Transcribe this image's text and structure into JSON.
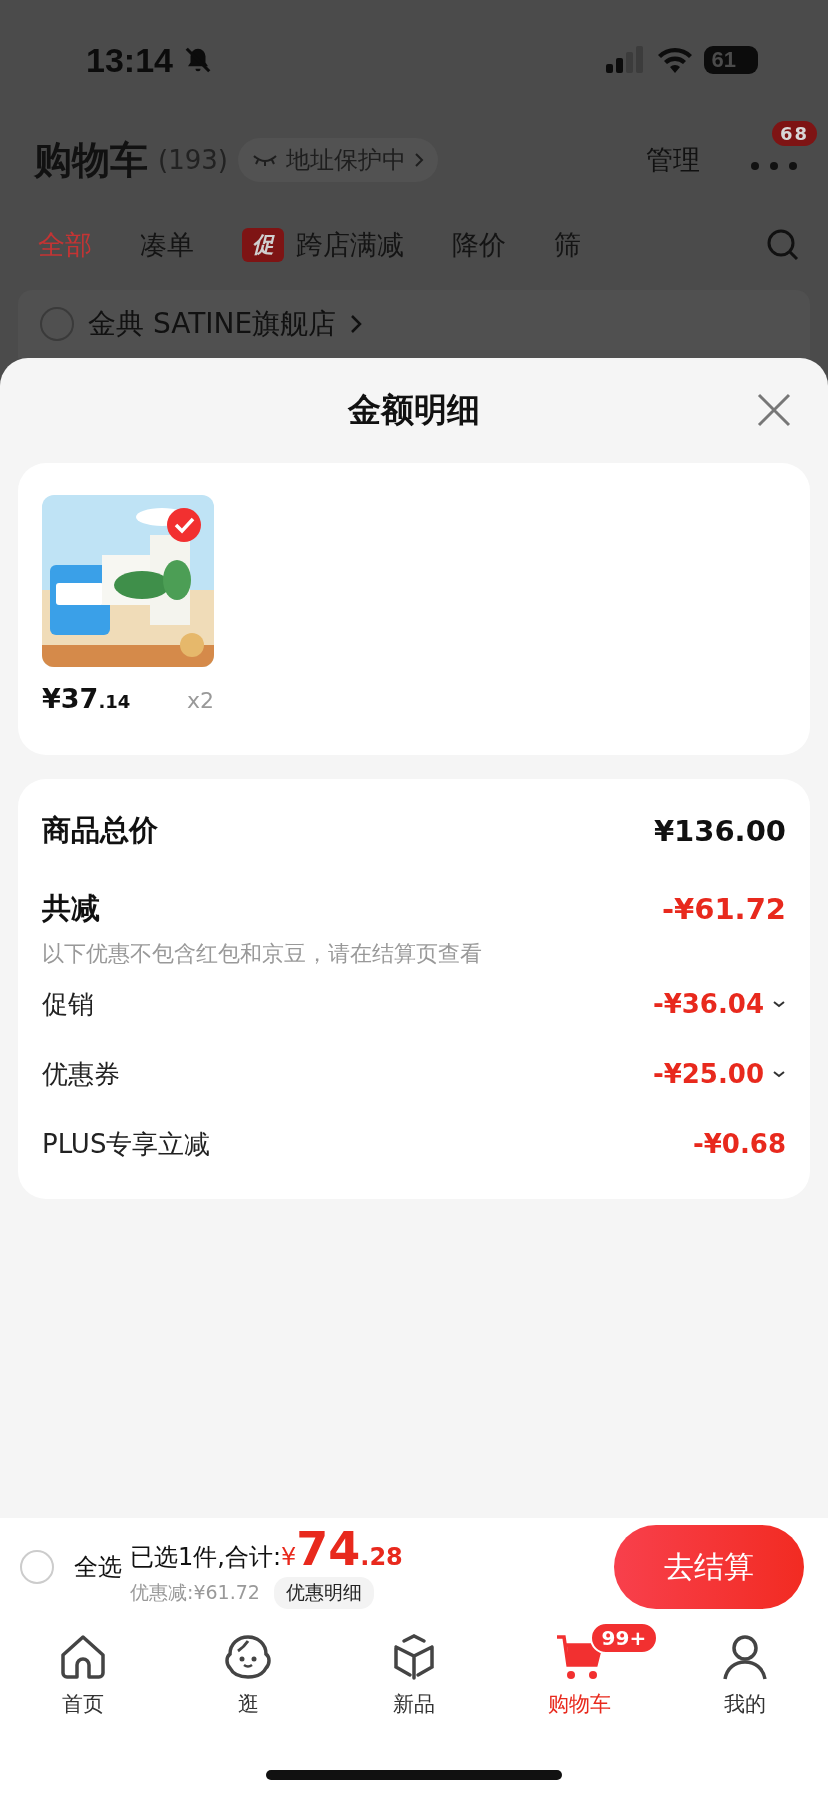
{
  "status_bar": {
    "time": "13:14",
    "battery": "61"
  },
  "header": {
    "title": "购物车",
    "count": "(193)",
    "address_badge": "地址保护中",
    "manage": "管理",
    "more_badge": "68"
  },
  "filter_tabs": [
    {
      "label": "全部",
      "selected": true
    },
    {
      "label": "凑单",
      "selected": false
    },
    {
      "label": "跨店满减",
      "selected": false,
      "tag": "促"
    },
    {
      "label": "降价",
      "selected": false
    },
    {
      "label": "筛",
      "selected": false
    }
  ],
  "store": {
    "name": "金典 SATINE旗舰店",
    "checked": false
  },
  "sheet": {
    "title": "金额明细",
    "items": [
      {
        "kind": "picture",
        "price": "¥37",
        "price_cents": ".14",
        "quantity": "x2",
        "checked": true
      }
    ],
    "summary": {
      "total": {
        "label": "商品总价",
        "value": "¥136.00"
      },
      "reduction": {
        "label": "共减",
        "value": "-¥61.72",
        "note": "以下优惠不包含红包和京豆，请在结算页查看"
      },
      "details": [
        {
          "label": "促销",
          "value": "-¥36.04",
          "expandable": true
        },
        {
          "label": "优惠券",
          "value": "-¥25.00",
          "expandable": true
        },
        {
          "label": "PLUS专享立减",
          "value": "-¥0.68",
          "expandable": false
        }
      ]
    }
  },
  "checkout": {
    "select_all": {
      "label": "全选",
      "checked": false
    },
    "selected_text": "已选1件,合计:",
    "currency": "¥",
    "total": "74",
    "total_cents": ".28",
    "discount": "优惠减:¥61.72",
    "detail_button": "优惠明细",
    "checkout_button": "去结算"
  },
  "tab_bar": [
    {
      "label": "首页",
      "selected": false
    },
    {
      "label": "逛",
      "selected": false
    },
    {
      "label": "新品",
      "selected": false
    },
    {
      "label": "购物车",
      "selected": true,
      "badge": "99+"
    },
    {
      "label": "我的",
      "selected": false
    }
  ]
}
